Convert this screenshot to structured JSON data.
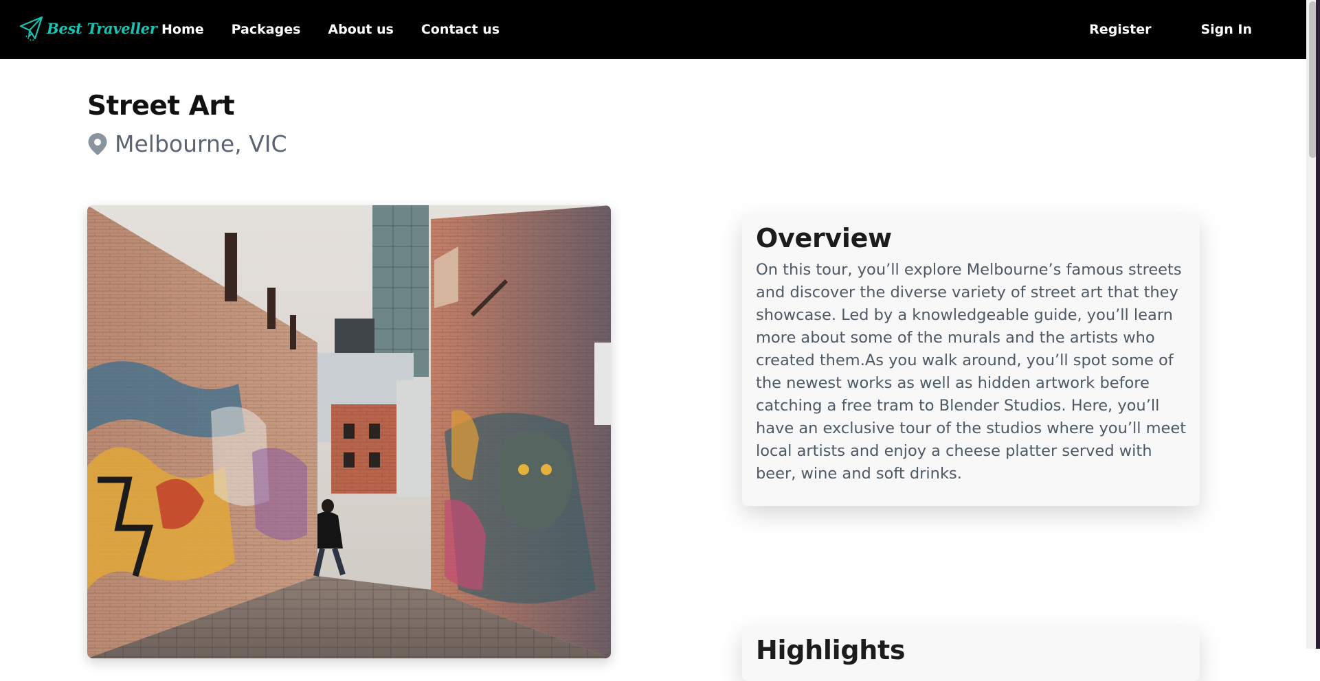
{
  "brand": {
    "name": "Best Traveller",
    "accent_color": "#19c3b4"
  },
  "nav": {
    "links": [
      "Home",
      "Packages",
      "About us",
      "Contact us"
    ],
    "register_label": "Register",
    "signin_label": "Sign In"
  },
  "page": {
    "title": "Street Art",
    "location": "Melbourne, VIC",
    "location_icon": "map-pin-icon",
    "image": "street-art-alley-photo"
  },
  "overview": {
    "heading": "Overview",
    "body": "On this tour, you’ll explore Melbourne’s famous streets and discover the diverse variety of street art that they showcase. Led by a knowledgeable guide, you’ll learn more about some of the murals and the artists who created them.As you walk around, you’ll spot some of the newest works as well as hidden artwork before catching a free tram to Blender Studios. Here, you’ll have an exclusive tour of the studios where you’ll meet local artists and enjoy a cheese platter served with beer, wine and soft drinks."
  },
  "highlights": {
    "heading": "Highlights"
  }
}
